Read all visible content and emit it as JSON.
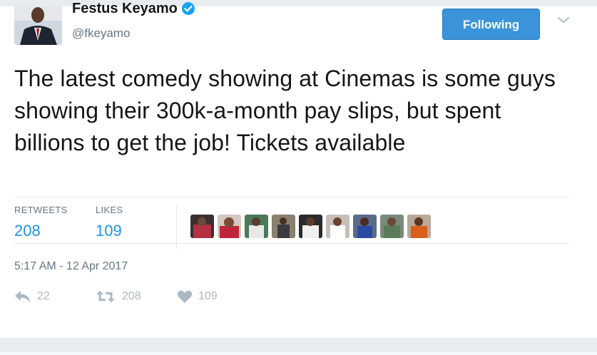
{
  "tweet": {
    "author_name": "Festus Keyamo",
    "author_handle": "@fkeyamo",
    "follow_label": "Following",
    "text": "The latest comedy showing at Cinemas is some guys showing their 300k-a-month pay slips, but spent billions to get the job! Tickets available",
    "timestamp": "5:17 AM - 12 Apr 2017"
  },
  "stats": {
    "retweets_label": "RETWEETS",
    "retweets_value": "208",
    "likes_label": "LIKES",
    "likes_value": "109"
  },
  "actions": {
    "reply_count": "22",
    "retweet_count": "208",
    "like_count": "109"
  },
  "icons": {
    "verified": "verified-badge-icon",
    "caret": "chevron-down-icon",
    "reply": "reply-icon",
    "retweet": "retweet-icon",
    "like": "heart-icon"
  },
  "colors": {
    "accent": "#1b95e0",
    "button": "#3b94d9",
    "muted": "#657786",
    "action_gray": "#aab8c2"
  }
}
